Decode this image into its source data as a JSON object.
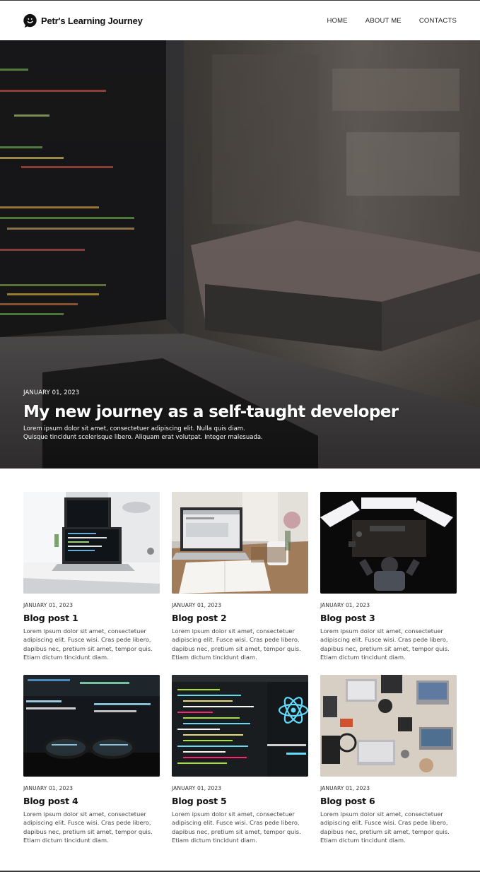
{
  "header": {
    "brand_name": "Petr's Learning Journey",
    "brand_icon": "speech-bubble-icon",
    "nav": [
      {
        "label": "HOME"
      },
      {
        "label": "ABOUT ME"
      },
      {
        "label": "CONTACTS"
      }
    ]
  },
  "hero": {
    "date": "JANUARY 01, 2023",
    "title": "My new journey as a self-taught developer",
    "excerpt": "Lorem ipsum dolor sit amet, consectetuer adipiscing elit. Nulla quis diam. Quisque tincidunt scelerisque libero. Aliquam erat volutpat. Integer malesuada.",
    "image": "laptop-with-code-and-book-photo"
  },
  "posts": [
    {
      "date": "JANUARY 01, 2023",
      "title": "Blog post 1",
      "excerpt": "Lorem ipsum dolor sit amet, consectetuer adipiscing elit. Fusce wisi. Cras pede libero, dapibus nec, pretium sit amet, tempor quis. Etiam dictum tincidunt diam.",
      "image": "laptop-on-white-desk-photo"
    },
    {
      "date": "JANUARY 01, 2023",
      "title": "Blog post 2",
      "excerpt": "Lorem ipsum dolor sit amet, consectetuer adipiscing elit. Fusce wisi. Cras pede libero, dapibus nec, pretium sit amet, tempor quis. Etiam dictum tincidunt diam.",
      "image": "laptop-notebook-mug-photo"
    },
    {
      "date": "JANUARY 01, 2023",
      "title": "Blog post 3",
      "excerpt": "Lorem ipsum dolor sit amet, consectetuer adipiscing elit. Fusce wisi. Cras pede libero, dapibus nec, pretium sit amet, tempor quis. Etiam dictum tincidunt diam.",
      "image": "person-at-multi-monitor-desk-photo"
    },
    {
      "date": "JANUARY 01, 2023",
      "title": "Blog post 4",
      "excerpt": "Lorem ipsum dolor sit amet, consectetuer adipiscing elit. Fusce wisi. Cras pede libero, dapibus nec, pretium sit amet, tempor quis. Etiam dictum tincidunt diam.",
      "image": "glasses-in-front-of-monitor-photo"
    },
    {
      "date": "JANUARY 01, 2023",
      "title": "Blog post 5",
      "excerpt": "Lorem ipsum dolor sit amet, consectetuer adipiscing elit. Fusce wisi. Cras pede libero, dapibus nec, pretium sit amet, tempor quis. Etiam dictum tincidunt diam.",
      "image": "react-code-screen-photo"
    },
    {
      "date": "JANUARY 01, 2023",
      "title": "Blog post 6",
      "excerpt": "Lorem ipsum dolor sit amet, consectetuer adipiscing elit. Fusce wisi. Cras pede libero, dapibus nec, pretium sit amet, tempor quis. Etiam dictum tincidunt diam.",
      "image": "team-desk-top-view-photo"
    }
  ],
  "colors": {
    "background": "#ffffff",
    "text": "#111111",
    "hero_overlay": "#2b2a2a"
  }
}
